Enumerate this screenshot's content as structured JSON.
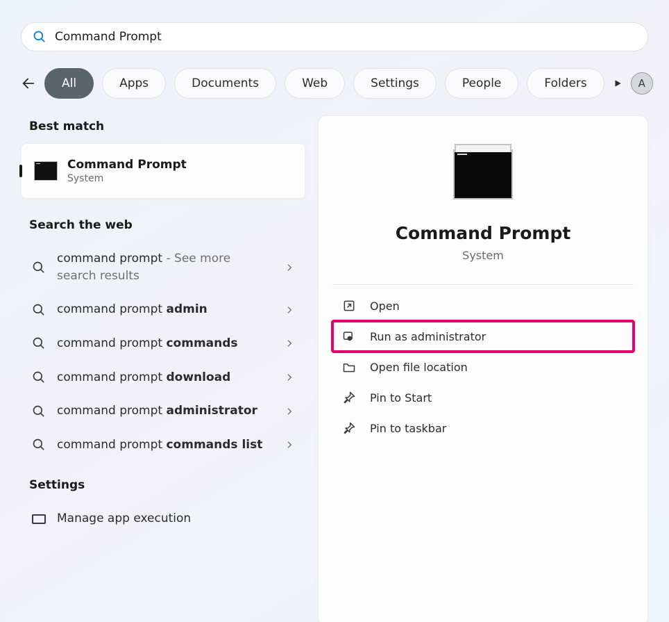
{
  "search": {
    "value": "Command Prompt"
  },
  "filters": {
    "items": [
      "All",
      "Apps",
      "Documents",
      "Web",
      "Settings",
      "People",
      "Folders"
    ],
    "activeIndex": 0
  },
  "profile": {
    "initial": "A"
  },
  "left": {
    "bestMatchHeading": "Best match",
    "searchWebHeading": "Search the web",
    "settingsHeading": "Settings",
    "best": {
      "title": "Command Prompt",
      "subtitle": "System"
    },
    "web": [
      {
        "plain": "command prompt",
        "bold": "",
        "suffix": " - See more search results"
      },
      {
        "plain": "command prompt ",
        "bold": "admin",
        "suffix": ""
      },
      {
        "plain": "command prompt ",
        "bold": "commands",
        "suffix": ""
      },
      {
        "plain": "command prompt ",
        "bold": "download",
        "suffix": ""
      },
      {
        "plain": "command prompt ",
        "bold": "administrator",
        "suffix": ""
      },
      {
        "plain": "command prompt ",
        "bold": "commands list",
        "suffix": ""
      }
    ],
    "settingsItems": [
      "Manage app execution"
    ]
  },
  "preview": {
    "title": "Command Prompt",
    "subtitle": "System",
    "actions": [
      {
        "id": "open",
        "label": "Open",
        "icon": "open"
      },
      {
        "id": "run-admin",
        "label": "Run as administrator",
        "icon": "admin",
        "highlight": true
      },
      {
        "id": "file-location",
        "label": "Open file location",
        "icon": "folder"
      },
      {
        "id": "pin-start",
        "label": "Pin to Start",
        "icon": "pin"
      },
      {
        "id": "pin-taskbar",
        "label": "Pin to taskbar",
        "icon": "pin"
      }
    ]
  }
}
